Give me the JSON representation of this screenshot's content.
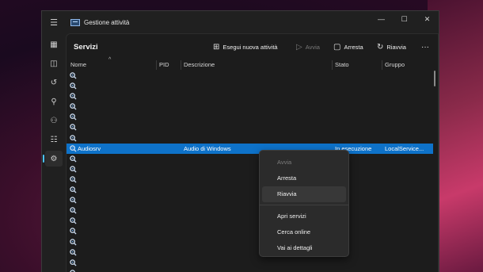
{
  "window": {
    "title": "Gestione attività",
    "controls": [
      "minimize-icon",
      "maximize-icon",
      "close-icon"
    ]
  },
  "sidebar": {
    "items": [
      {
        "name": "hamburger-menu-icon"
      },
      {
        "name": "processes-icon"
      },
      {
        "name": "performance-icon"
      },
      {
        "name": "app-history-icon"
      },
      {
        "name": "startup-apps-icon"
      },
      {
        "name": "users-icon"
      },
      {
        "name": "details-icon"
      },
      {
        "name": "services-icon",
        "active": true
      }
    ]
  },
  "toolbar": {
    "page_title": "Servizi",
    "run_new_task": "Esegui nuova attività",
    "start": "Avvia",
    "stop": "Arresta",
    "restart": "Riavvia",
    "more": "···"
  },
  "table": {
    "columns": [
      "Nome",
      "PID",
      "Descrizione",
      "Stato",
      "Gruppo"
    ],
    "selected_row": {
      "name": "Audiosrv",
      "pid": "",
      "description": "Audio di Windows",
      "status": "In esecuzione",
      "group": "LocalService..."
    }
  },
  "context_menu": {
    "items": [
      {
        "label": "Avvia",
        "disabled": true
      },
      {
        "label": "Arresta"
      },
      {
        "label": "Riavvia",
        "hover": true
      },
      {
        "label": "Apri servizi"
      },
      {
        "label": "Cerca online"
      },
      {
        "label": "Vai ai dettagli"
      }
    ]
  },
  "colors": {
    "accent": "#4cc2ff",
    "selection": "#0e72c9"
  }
}
